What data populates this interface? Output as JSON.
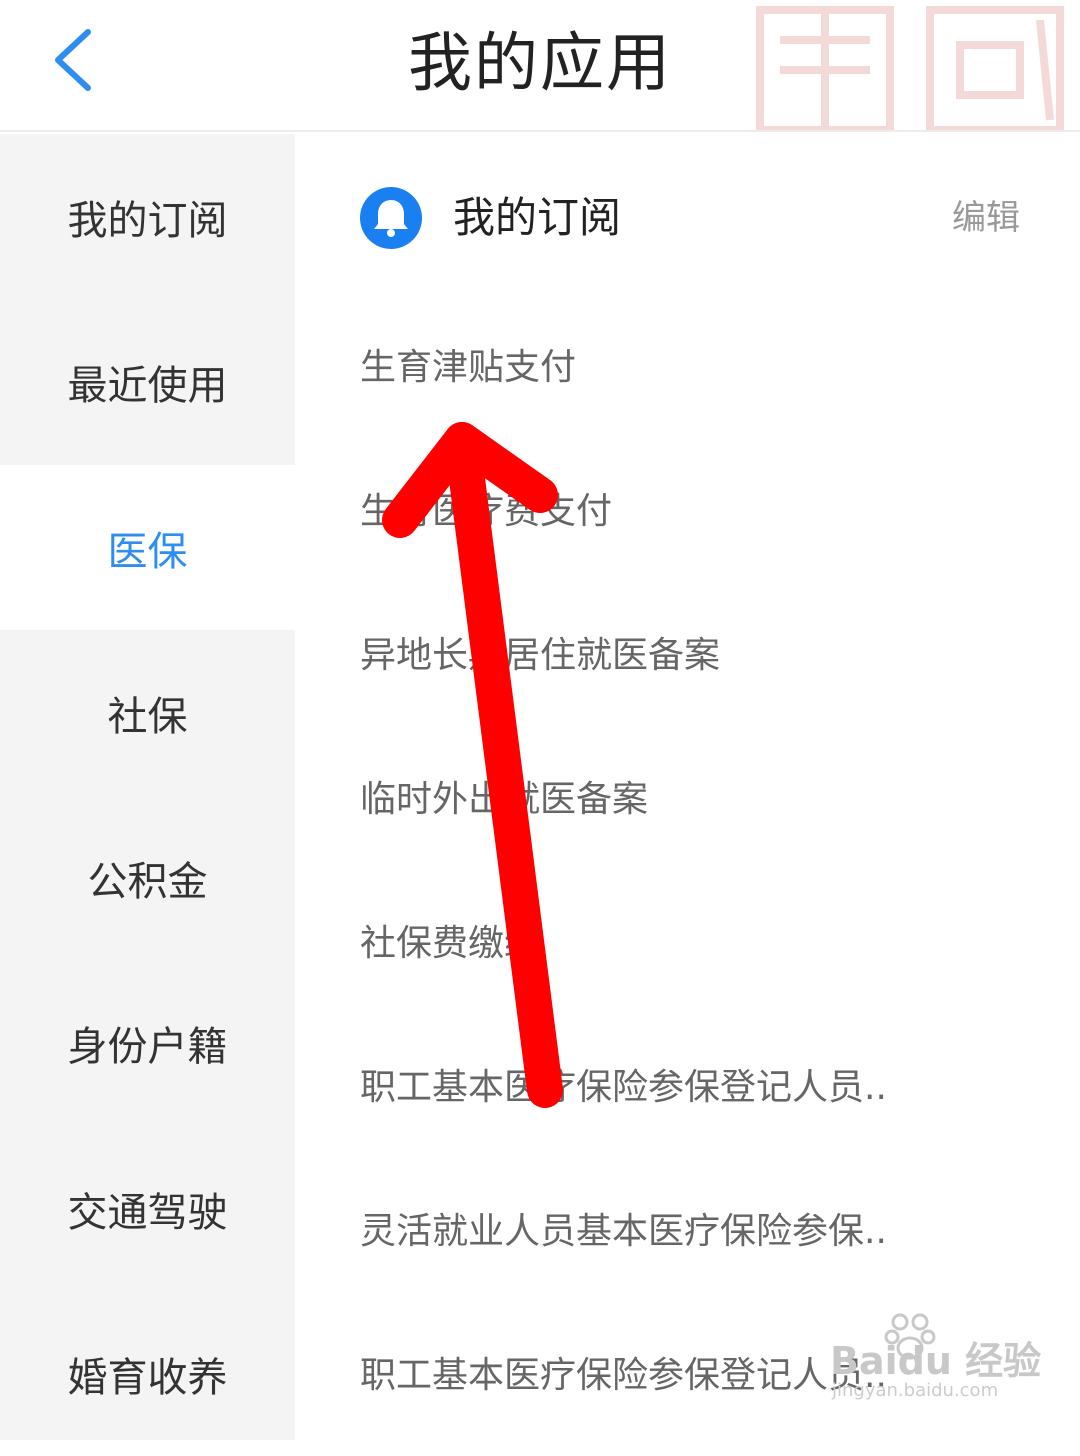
{
  "header": {
    "title": "我的应用",
    "back_icon": "chevron-left-icon",
    "accent_color": "#2e8ef0"
  },
  "sidebar": {
    "active_index": 2,
    "items": [
      {
        "label": "我的订阅"
      },
      {
        "label": "最近使用"
      },
      {
        "label": "医保"
      },
      {
        "label": "社保"
      },
      {
        "label": "公积金"
      },
      {
        "label": "身份户籍"
      },
      {
        "label": "交通驾驶"
      },
      {
        "label": "婚育收养"
      }
    ]
  },
  "section": {
    "icon": "bell-icon",
    "title": "我的订阅",
    "edit_label": "编辑"
  },
  "apps": [
    {
      "label": "生育津贴支付"
    },
    {
      "label": "生育医疗费支付"
    },
    {
      "label": "异地长期居住就医备案"
    },
    {
      "label": "临时外出就医备案"
    },
    {
      "label": "社保费缴纳"
    },
    {
      "label": "职工基本医疗保险参保登记人员.."
    },
    {
      "label": "灵活就业人员基本医疗保险参保.."
    },
    {
      "label": "职工基本医疗保险参保登记人员.."
    }
  ],
  "annotation": {
    "arrow_color": "#ff0000"
  },
  "watermark": {
    "brand": "Baidu 经验",
    "url": "jingyan.baidu.com"
  }
}
